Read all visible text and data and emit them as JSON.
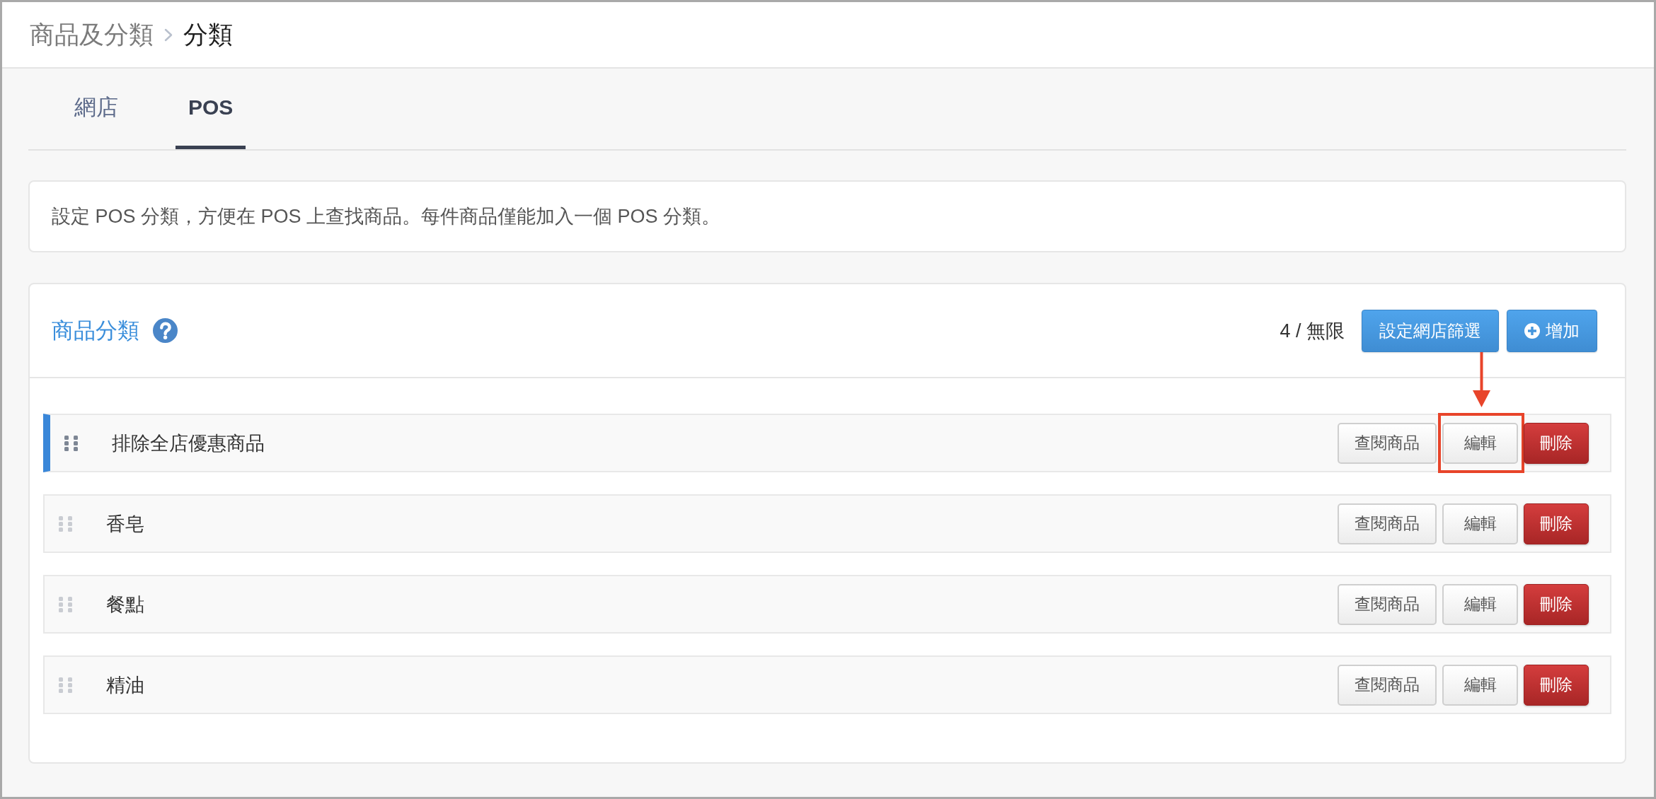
{
  "breadcrumb": [
    {
      "label": "商品及分類",
      "current": false
    },
    {
      "label": "分類",
      "current": true
    }
  ],
  "tabs": [
    {
      "label": "網店",
      "selected": false
    },
    {
      "label": "POS",
      "selected": true
    }
  ],
  "notice": {
    "text": "設定 POS 分類，方便在 POS 上查找商品。每件商品僅能加入一個 POS 分類。"
  },
  "category_panel": {
    "title": "商品分類",
    "count": "4 / 無限",
    "actions": [
      {
        "label": "設定網店篩選",
        "kind": "text"
      },
      {
        "label": "增加",
        "kind": "add"
      }
    ],
    "rows": [
      {
        "name": "排除全店優惠商品",
        "selected": true,
        "buttons": [
          {
            "label": "查閱商品",
            "kind": "default",
            "highlighted": false
          },
          {
            "label": "編輯",
            "kind": "default",
            "highlighted": true
          },
          {
            "label": "刪除",
            "kind": "danger",
            "highlighted": false
          }
        ]
      },
      {
        "name": "香皂",
        "selected": false,
        "buttons": [
          {
            "label": "查閱商品",
            "kind": "default",
            "highlighted": false
          },
          {
            "label": "編輯",
            "kind": "default",
            "highlighted": false
          },
          {
            "label": "刪除",
            "kind": "danger",
            "highlighted": false
          }
        ]
      },
      {
        "name": "餐點",
        "selected": false,
        "buttons": [
          {
            "label": "查閱商品",
            "kind": "default",
            "highlighted": false
          },
          {
            "label": "編輯",
            "kind": "default",
            "highlighted": false
          },
          {
            "label": "刪除",
            "kind": "danger",
            "highlighted": false
          }
        ]
      },
      {
        "name": "精油",
        "selected": false,
        "buttons": [
          {
            "label": "查閱商品",
            "kind": "default",
            "highlighted": false
          },
          {
            "label": "編輯",
            "kind": "default",
            "highlighted": false
          },
          {
            "label": "刪除",
            "kind": "danger",
            "highlighted": false
          }
        ]
      }
    ]
  }
}
